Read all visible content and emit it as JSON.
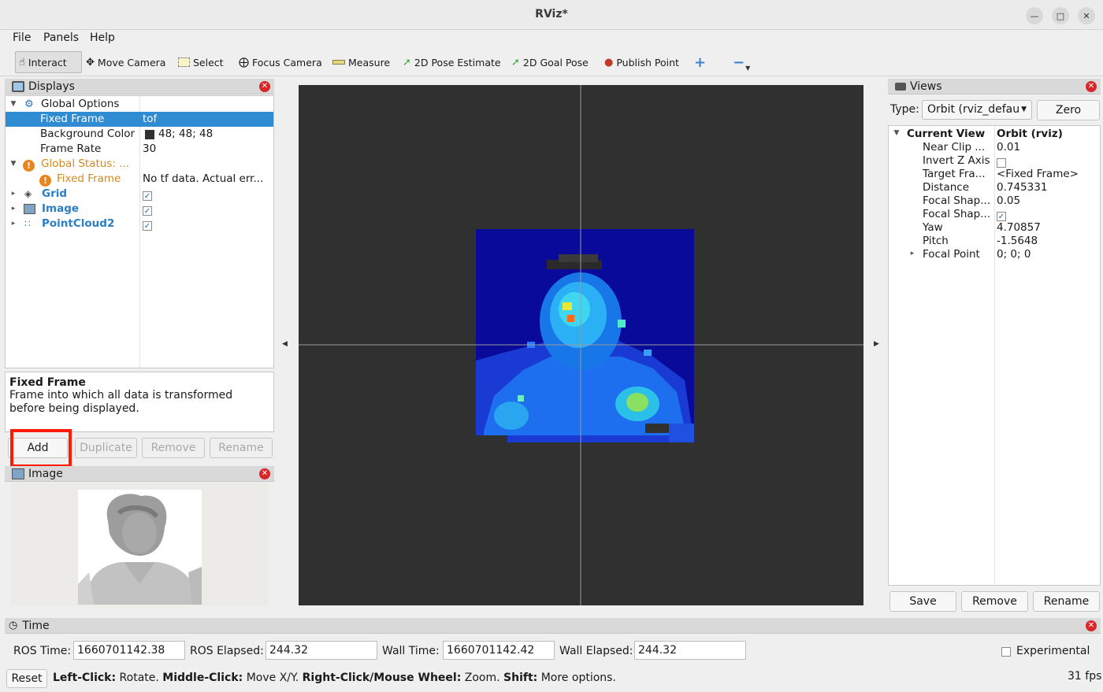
{
  "window": {
    "title": "RViz*"
  },
  "menu": {
    "file": "File",
    "panels": "Panels",
    "help": "Help"
  },
  "toolbar": {
    "interact": "Interact",
    "move_camera": "Move Camera",
    "select": "Select",
    "focus_camera": "Focus Camera",
    "measure": "Measure",
    "pose_estimate": "2D Pose Estimate",
    "goal_pose": "2D Goal Pose",
    "publish_point": "Publish Point"
  },
  "displays": {
    "title": "Displays",
    "rows": [
      {
        "name": "Global Options",
        "value": ""
      },
      {
        "name": "Fixed Frame",
        "value": "tof"
      },
      {
        "name": "Background Color",
        "value": "48; 48; 48"
      },
      {
        "name": "Frame Rate",
        "value": "30"
      },
      {
        "name": "Global Status: ...",
        "value": ""
      },
      {
        "name": "Fixed Frame",
        "value": "No tf data.  Actual err..."
      },
      {
        "name": "Grid",
        "value": "",
        "checked": true
      },
      {
        "name": "Image",
        "value": "",
        "checked": true
      },
      {
        "name": "PointCloud2",
        "value": "",
        "checked": true
      }
    ],
    "background_color": "#303030",
    "description_title": "Fixed Frame",
    "description_text": "Frame into which all data is transformed before being displayed.",
    "buttons": {
      "add": "Add",
      "duplicate": "Duplicate",
      "remove": "Remove",
      "rename": "Rename"
    }
  },
  "image_panel": {
    "title": "Image"
  },
  "views": {
    "title": "Views",
    "type_label": "Type:",
    "type_value": "Orbit (rviz_defau",
    "zero": "Zero",
    "rows": [
      {
        "name": "Current View",
        "value": "Orbit (rviz)"
      },
      {
        "name": "Near Clip ...",
        "value": "0.01"
      },
      {
        "name": "Invert Z Axis",
        "value": ""
      },
      {
        "name": "Target Fra...",
        "value": "<Fixed Frame>"
      },
      {
        "name": "Distance",
        "value": "0.745331"
      },
      {
        "name": "Focal Shap...",
        "value": "0.05"
      },
      {
        "name": "Focal Shap...",
        "value": ""
      },
      {
        "name": "Yaw",
        "value": "4.70857"
      },
      {
        "name": "Pitch",
        "value": "-1.5648"
      },
      {
        "name": "Focal Point",
        "value": "0; 0; 0"
      }
    ],
    "buttons": {
      "save": "Save",
      "remove": "Remove",
      "rename": "Rename"
    }
  },
  "time": {
    "title": "Time",
    "ros_time_label": "ROS Time:",
    "ros_time": "1660701142.38",
    "ros_elapsed_label": "ROS Elapsed:",
    "ros_elapsed": "244.32",
    "wall_time_label": "Wall Time:",
    "wall_time": "1660701142.42",
    "wall_elapsed_label": "Wall Elapsed:",
    "wall_elapsed": "244.32",
    "experimental": "Experimental"
  },
  "status": {
    "reset": "Reset",
    "k1": "Left-Click:",
    "v1": " Rotate. ",
    "k2": "Middle-Click:",
    "v2": " Move X/Y. ",
    "k3": "Right-Click/Mouse Wheel:",
    "v3": " Zoom. ",
    "k4": "Shift:",
    "v4": " More options.",
    "fps": "31 fps"
  },
  "colors": {
    "selection": "#2f8bd2",
    "highlight": "#ff1a00",
    "viewport_bg": "#303030"
  }
}
